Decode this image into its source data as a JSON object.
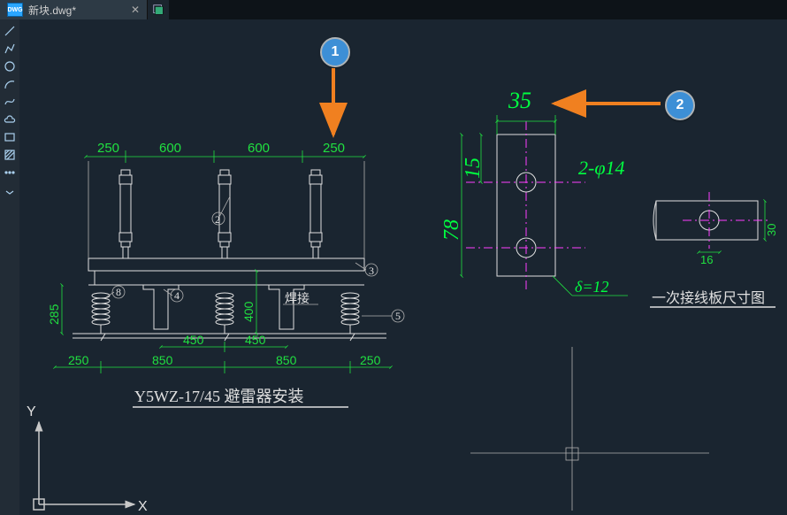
{
  "tab": {
    "filename": "新块.dwg*",
    "icon_label": "DWG"
  },
  "tools": [
    {
      "name": "line-tool",
      "icon": "line"
    },
    {
      "name": "polyline-tool",
      "icon": "polyline"
    },
    {
      "name": "circle-tool",
      "icon": "circle"
    },
    {
      "name": "arc-tool",
      "icon": "arc"
    },
    {
      "name": "spline-tool",
      "icon": "spline"
    },
    {
      "name": "cloud-tool",
      "icon": "cloud"
    },
    {
      "name": "rectangle-tool",
      "icon": "rect"
    },
    {
      "name": "hatch-tool",
      "icon": "hatch"
    },
    {
      "name": "more-tool",
      "icon": "more"
    },
    {
      "name": "expand-tool",
      "icon": "expand"
    }
  ],
  "annotations": {
    "n1": "1",
    "n2": "2"
  },
  "left_drawing": {
    "top_dims": [
      "250",
      "600",
      "600",
      "250"
    ],
    "refs": [
      "2",
      "3",
      "8",
      "4",
      "5"
    ],
    "side_dim_left": "285",
    "side_dim_mid": "400",
    "weld_label": "焊接",
    "mid_dims": [
      "450",
      "450"
    ],
    "bot_dims": [
      "250",
      "850",
      "850",
      "250"
    ],
    "title": "Y5WZ-17/45 避雷器安装"
  },
  "right_drawing": {
    "dim_35": "35",
    "dim_15": "15",
    "dim_78": "78",
    "hole_spec": "2-φ14",
    "delta": "δ=12",
    "dim_30": "30",
    "dim_16": "16",
    "title2": "一次接线板尺寸图"
  },
  "axes": {
    "x": "X",
    "y": "Y"
  }
}
